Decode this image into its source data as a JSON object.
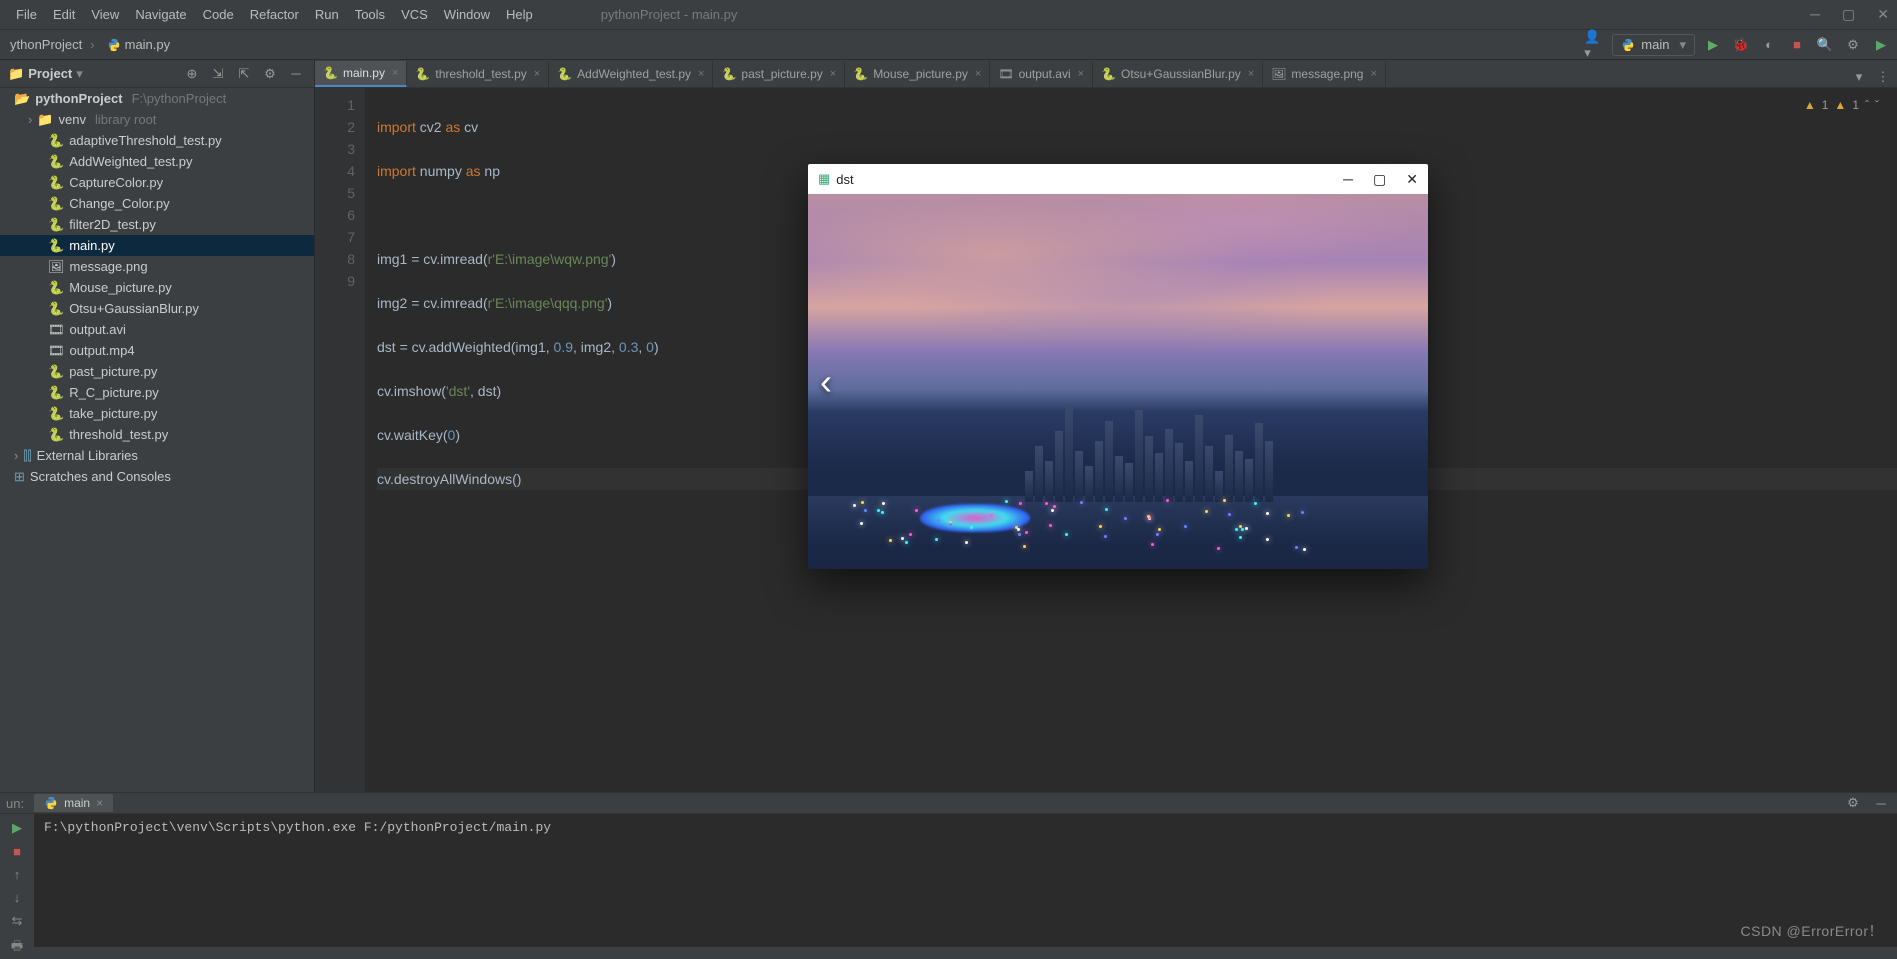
{
  "menu": {
    "items": [
      "File",
      "Edit",
      "View",
      "Navigate",
      "Code",
      "Refactor",
      "Run",
      "Tools",
      "VCS",
      "Window",
      "Help"
    ],
    "window_title": "pythonProject - main.py"
  },
  "breadcrumb": {
    "project": "ythonProject",
    "file": "main.py"
  },
  "run_config": {
    "name": "main"
  },
  "warnings": {
    "w1": "1",
    "w2": "1"
  },
  "project_header": {
    "title": "Project"
  },
  "tree": {
    "root": {
      "name": "pythonProject",
      "path": "F:\\pythonProject"
    },
    "venv": {
      "name": "venv",
      "hint": "library root"
    },
    "files": [
      "adaptiveThreshold_test.py",
      "AddWeighted_test.py",
      "CaptureColor.py",
      "Change_Color.py",
      "filter2D_test.py",
      "main.py",
      "message.png",
      "Mouse_picture.py",
      "Otsu+GaussianBlur.py",
      "output.avi",
      "output.mp4",
      "past_picture.py",
      "R_C_picture.py",
      "take_picture.py",
      "threshold_test.py"
    ],
    "external": "External Libraries",
    "scratches": "Scratches and Consoles"
  },
  "tabs": [
    {
      "label": "main.py",
      "active": true
    },
    {
      "label": "threshold_test.py"
    },
    {
      "label": "AddWeighted_test.py"
    },
    {
      "label": "past_picture.py"
    },
    {
      "label": "Mouse_picture.py"
    },
    {
      "label": "output.avi"
    },
    {
      "label": "Otsu+GaussianBlur.py"
    },
    {
      "label": "message.png"
    }
  ],
  "code": {
    "lines": [
      "1",
      "2",
      "3",
      "4",
      "5",
      "6",
      "7",
      "8",
      "9"
    ],
    "l1a": "import",
    "l1b": " cv2 ",
    "l1c": "as",
    "l1d": " cv",
    "l2a": "import",
    "l2b": " numpy ",
    "l2c": "as",
    "l2d": " np",
    "l4a": "img1 = cv.imread(",
    "l4b": "r'E:\\image\\wqw.png'",
    "l4c": ")",
    "l5a": "img2 = cv.imread(",
    "l5b": "r'E:\\image\\qqq.png'",
    "l5c": ")",
    "l6a": "dst = cv.addWeighted(img1, ",
    "l6b": "0.9",
    "l6c": ", img2, ",
    "l6d": "0.3",
    "l6e": ", ",
    "l6f": "0",
    "l6g": ")",
    "l7a": "cv.imshow(",
    "l7b": "'dst'",
    "l7c": ", dst)",
    "l8a": "cv.waitKey(",
    "l8b": "0",
    "l8c": ")",
    "l9a": "cv.destroyAllWindows()"
  },
  "run": {
    "label": "un:",
    "tab": "main",
    "output": "F:\\pythonProject\\venv\\Scripts\\python.exe F:/pythonProject/main.py"
  },
  "popup": {
    "title": "dst"
  },
  "watermark": "CSDN @ErrorError！"
}
